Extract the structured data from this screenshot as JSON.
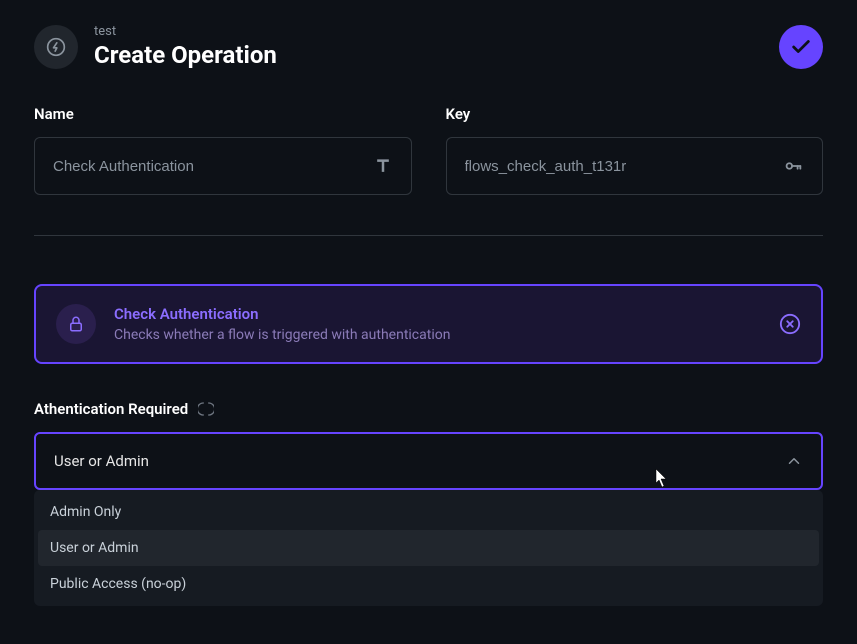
{
  "header": {
    "breadcrumb": "test",
    "title": "Create Operation"
  },
  "form": {
    "name": {
      "label": "Name",
      "value": "Check Authentication"
    },
    "key": {
      "label": "Key",
      "value": "flows_check_auth_t131r"
    }
  },
  "card": {
    "title": "Check Authentication",
    "description": "Checks whether a flow is triggered with authentication"
  },
  "auth_field": {
    "label": "Athentication Required",
    "selected": "User or Admin",
    "options": [
      "Admin Only",
      "User or Admin",
      "Public Access (no-op)"
    ]
  }
}
